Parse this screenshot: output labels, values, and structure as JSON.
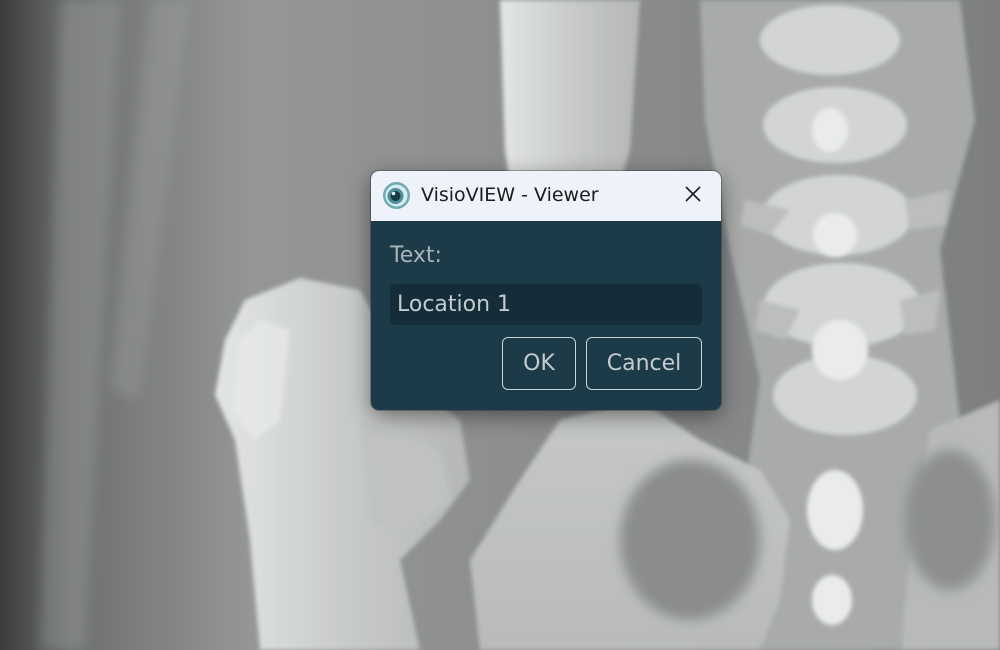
{
  "dialog": {
    "title": "VisioVIEW - Viewer",
    "app_icon": "visioview-eye-icon",
    "close_icon": "close-icon",
    "field_label": "Text:",
    "input_value": "Location 1",
    "ok_label": "OK",
    "cancel_label": "Cancel"
  },
  "colors": {
    "dialog_background": "#1c3a48",
    "titlebar_background": "#eef2fa",
    "input_background": "#142d38",
    "text": "#c3cbce"
  }
}
